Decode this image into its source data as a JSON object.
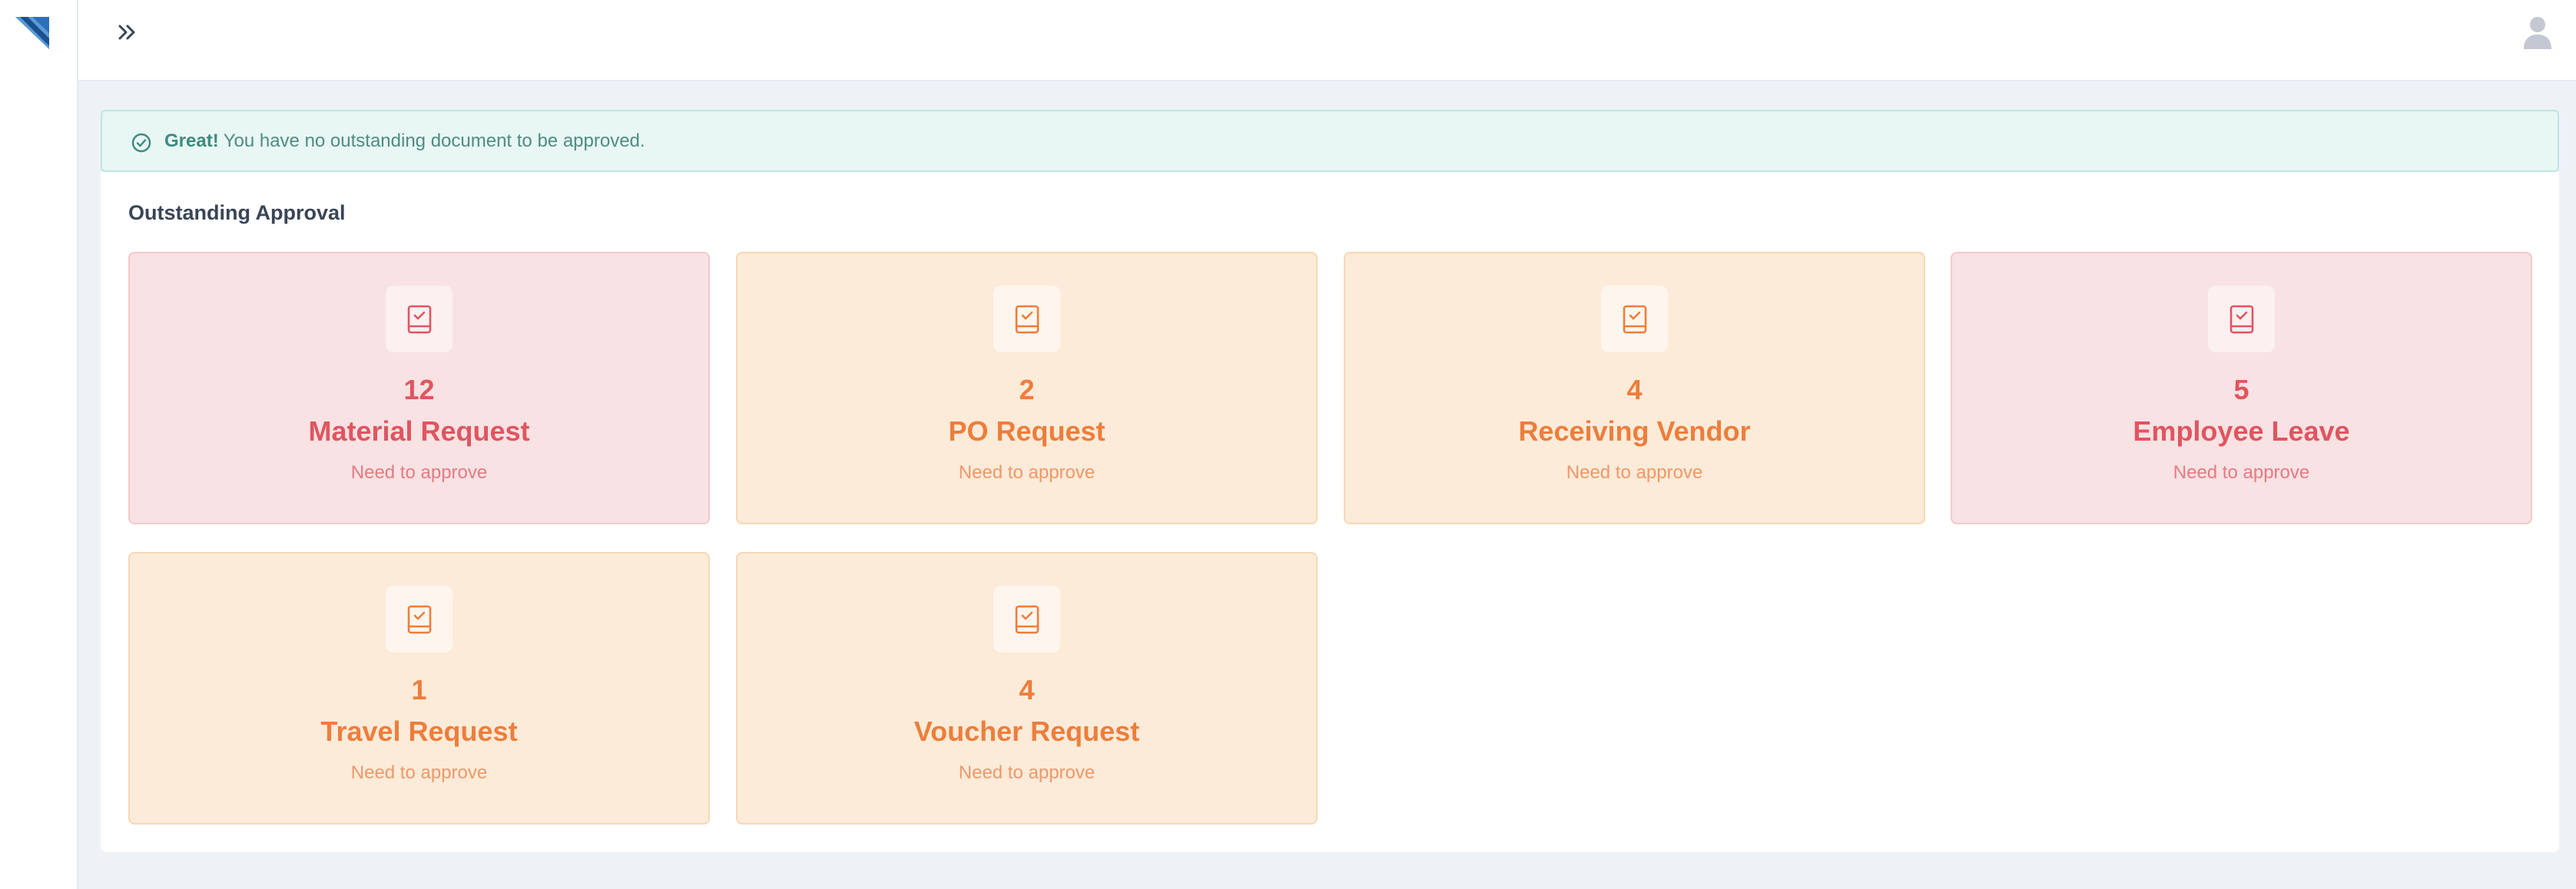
{
  "colors": {
    "brand": "#3a78c4",
    "red_text": "#e05560",
    "red_bg": "#f8e2e3",
    "orange_text": "#ee7d3c",
    "orange_bg": "#fcebd8",
    "success_text": "#3d8a7f",
    "success_bg": "#e8f6f4"
  },
  "header": {
    "toggle_icon": "double-chevron-right-icon",
    "user_icon": "user-avatar-icon"
  },
  "alert": {
    "strong": "Great!",
    "message": "You have no outstanding document to be approved.",
    "icon": "check-circle-icon"
  },
  "section": {
    "title": "Outstanding Approval"
  },
  "cards": [
    {
      "count": "12",
      "label": "Material Request",
      "sub": "Need to approve",
      "tone": "red",
      "icon": "book-check-icon"
    },
    {
      "count": "2",
      "label": "PO Request",
      "sub": "Need to approve",
      "tone": "orange",
      "icon": "book-check-icon"
    },
    {
      "count": "4",
      "label": "Receiving Vendor",
      "sub": "Need to approve",
      "tone": "orange",
      "icon": "book-check-icon"
    },
    {
      "count": "5",
      "label": "Employee Leave",
      "sub": "Need to approve",
      "tone": "red",
      "icon": "book-check-icon"
    },
    {
      "count": "1",
      "label": "Travel Request",
      "sub": "Need to approve",
      "tone": "orange",
      "icon": "book-check-icon"
    },
    {
      "count": "4",
      "label": "Voucher Request",
      "sub": "Need to approve",
      "tone": "orange",
      "icon": "book-check-icon"
    }
  ]
}
